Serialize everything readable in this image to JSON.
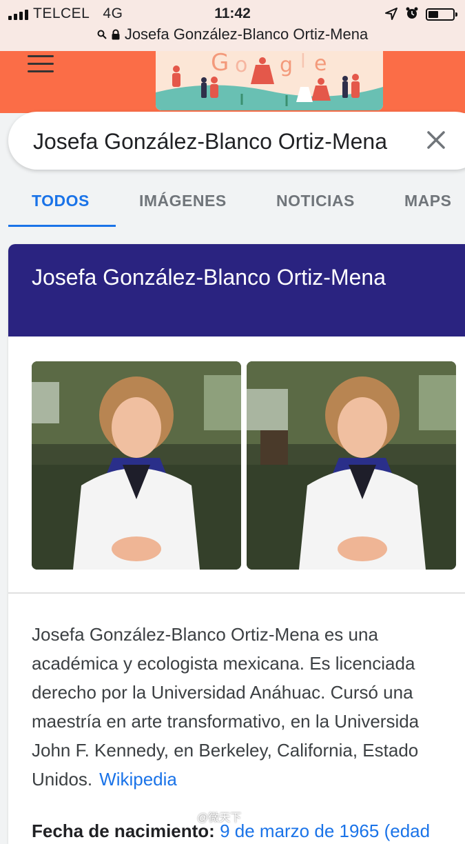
{
  "status_bar": {
    "carrier": "TELCEL",
    "network": "4G",
    "time": "11:42",
    "icons": [
      "signal-icon",
      "location-arrow-icon",
      "alarm-icon",
      "battery-icon"
    ],
    "battery_level": 0.42
  },
  "browser": {
    "url_text": "Josefa González-Blanco Ortiz-Mena"
  },
  "search": {
    "query": "Josefa González-Blanco Ortiz-Mena"
  },
  "tabs": [
    {
      "label": "TODOS",
      "active": true
    },
    {
      "label": "IMÁGENES",
      "active": false
    },
    {
      "label": "NOTICIAS",
      "active": false
    },
    {
      "label": "MAPS",
      "active": false
    }
  ],
  "knowledge_panel": {
    "title": "Josefa González-Blanco Ortiz-Mena",
    "description_lines": [
      "Josefa González-Blanco Ortiz-Mena es una",
      "académica y ecologista mexicana. Es licenciada",
      "derecho por la Universidad Anáhuac. Cursó una",
      "maestría en arte transformativo, en la Universida",
      "John F. Kennedy, en Berkeley, California, Estado",
      "Unidos."
    ],
    "source_link": "Wikipedia",
    "birth_label": "Fecha de nacimiento:",
    "birth_value": "9 de marzo de 1965 (edad"
  },
  "watermark": "@微天下",
  "colors": {
    "header_orange": "#fb6d47",
    "panel_header": "#2a2380",
    "link_blue": "#1a73e8"
  }
}
